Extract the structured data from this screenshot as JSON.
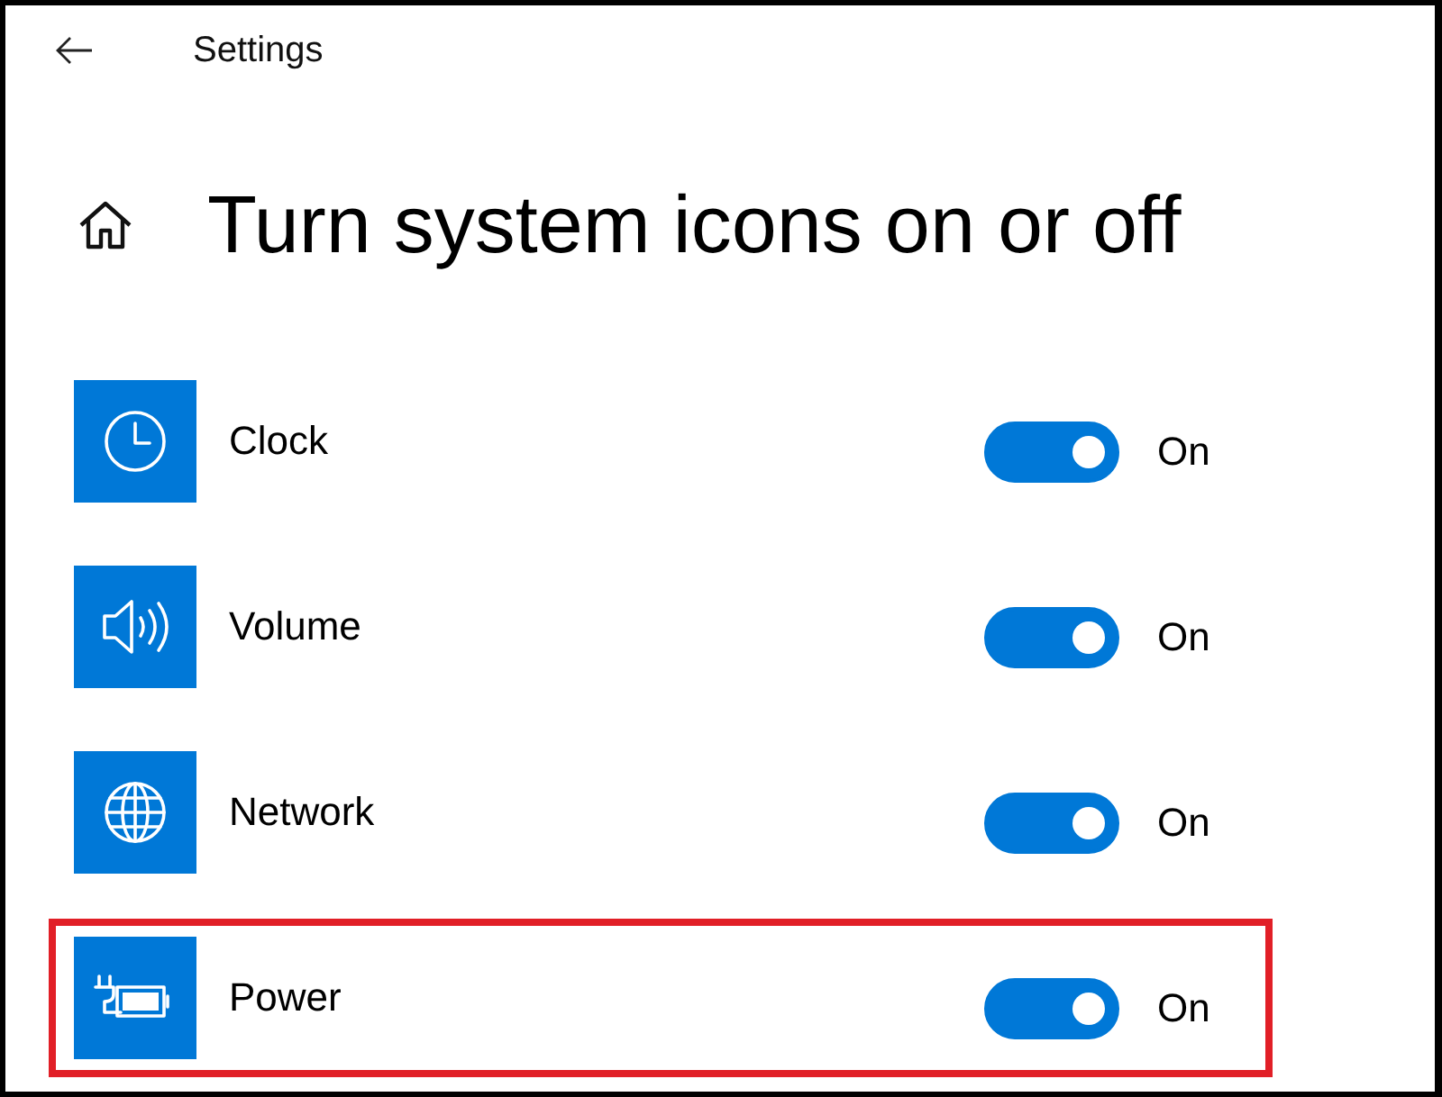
{
  "window": {
    "title": "Settings"
  },
  "page": {
    "title": "Turn system icons on or off"
  },
  "items": [
    {
      "label": "Clock",
      "on": true,
      "state_text": "On",
      "highlighted": false
    },
    {
      "label": "Volume",
      "on": true,
      "state_text": "On",
      "highlighted": false
    },
    {
      "label": "Network",
      "on": true,
      "state_text": "On",
      "highlighted": false
    },
    {
      "label": "Power",
      "on": true,
      "state_text": "On",
      "highlighted": true
    }
  ]
}
